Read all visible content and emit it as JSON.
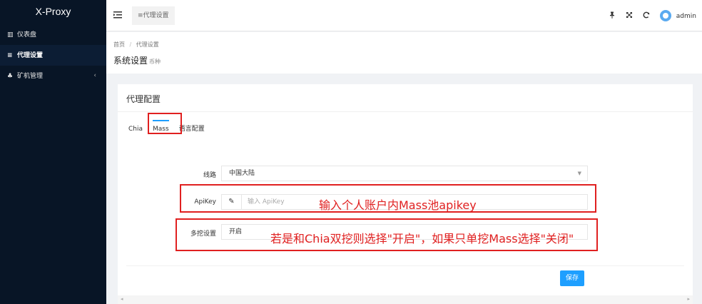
{
  "app": {
    "brand": "X-Proxy"
  },
  "sidebar": {
    "items": [
      {
        "label": "仪表盘",
        "icon": "bar-chart-icon"
      },
      {
        "label": "代理设置",
        "icon": "list-icon",
        "active": true
      },
      {
        "label": "矿机管理",
        "icon": "cluster-icon",
        "chevron": "‹"
      }
    ]
  },
  "header": {
    "tab_label": "≡代理设置",
    "user": "admin"
  },
  "breadcrumb": {
    "home": "首页",
    "sep": "/",
    "current": "代理设置"
  },
  "page": {
    "title": "系统设置",
    "subtitle": "币种"
  },
  "card": {
    "title": "代理配置",
    "tabs": [
      "Chia",
      "Mass",
      "语言配置"
    ],
    "active_tab": "Mass",
    "fields": {
      "route_label": "线路",
      "route_value": "中国大陆",
      "apikey_label": "ApiKey",
      "apikey_placeholder": "输入 ApiKey",
      "multi_label": "多挖设置",
      "multi_value": "开启"
    },
    "save_label": "保存"
  },
  "annotations": {
    "apikey_note": "输入个人账户内Mass池apikey",
    "multi_note": "若是和Chia双挖则选择\"开启\"，如果只单挖Mass选择\"关闭\""
  },
  "colors": {
    "sidebar_bg": "#081526",
    "accent": "#1e9fff",
    "annotation": "#e02020"
  }
}
